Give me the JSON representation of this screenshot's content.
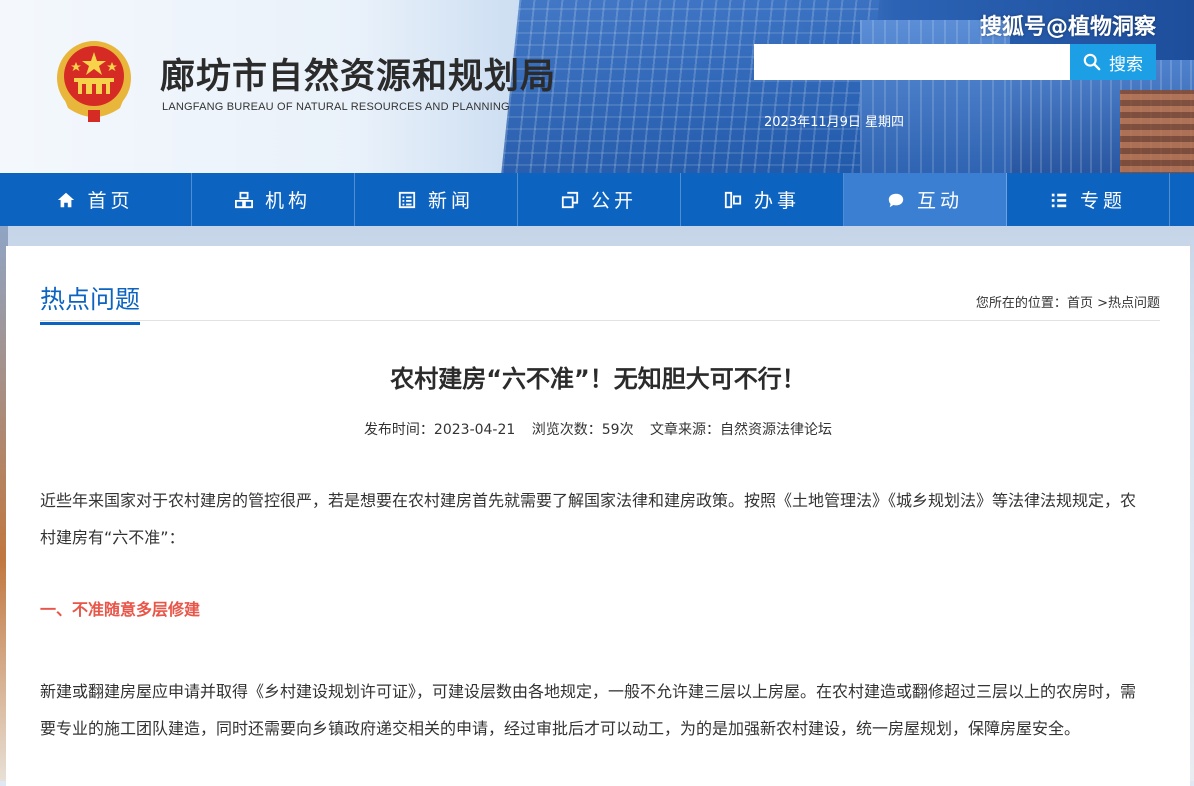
{
  "header": {
    "site_title": "廊坊市自然资源和规划局",
    "site_subtitle": "LANGFANG BUREAU OF NATURAL RESOURCES AND PLANNING",
    "watermark": "搜狐号@植物洞察",
    "search_placeholder": "",
    "search_label": "搜索",
    "date": "2023年11月9日 星期四"
  },
  "nav": {
    "items": [
      {
        "label": "首页",
        "icon": "home-icon"
      },
      {
        "label": "机构",
        "icon": "org-icon"
      },
      {
        "label": "新闻",
        "icon": "news-icon"
      },
      {
        "label": "公开",
        "icon": "open-icon"
      },
      {
        "label": "办事",
        "icon": "service-icon"
      },
      {
        "label": "互动",
        "icon": "chat-icon",
        "active": true
      },
      {
        "label": "专题",
        "icon": "list-icon"
      }
    ]
  },
  "section": {
    "title": "热点问题",
    "breadcrumb_prefix": "您所在的位置：",
    "breadcrumb_home": "首页",
    "breadcrumb_sep": " >",
    "breadcrumb_current": "热点问题"
  },
  "article": {
    "title": "农村建房“六不准”！无知胆大可不行！",
    "publish_time": "发布时间：2023-04-21",
    "views": "浏览次数：59次",
    "source": "文章来源：自然资源法律论坛",
    "paragraph1": "近些年来国家对于农村建房的管控很严，若是想要在农村建房首先就需要了解国家法律和建房政策。按照《土地管理法》《城乡规划法》等法律法规规定，农村建房有“六不准”：",
    "heading1": "一、不准随意多层修建",
    "paragraph2": "新建或翻建房屋应申请并取得《乡村建设规划许可证》，可建设层数由各地规定，一般不允许建三层以上房屋。在农村建造或翻修超过三层以上的农房时，需要专业的施工团队建造，同时还需要向乡镇政府递交相关的申请，经过审批后才可以动工，为的是加强新农村建设，统一房屋规划，保障房屋安全。"
  },
  "colors": {
    "nav_bg": "#0d63c0",
    "nav_active": "#3a7fd1",
    "search_button": "#1c9fe4",
    "section_title": "#0d63c0",
    "heading_red": "#e8564a"
  }
}
